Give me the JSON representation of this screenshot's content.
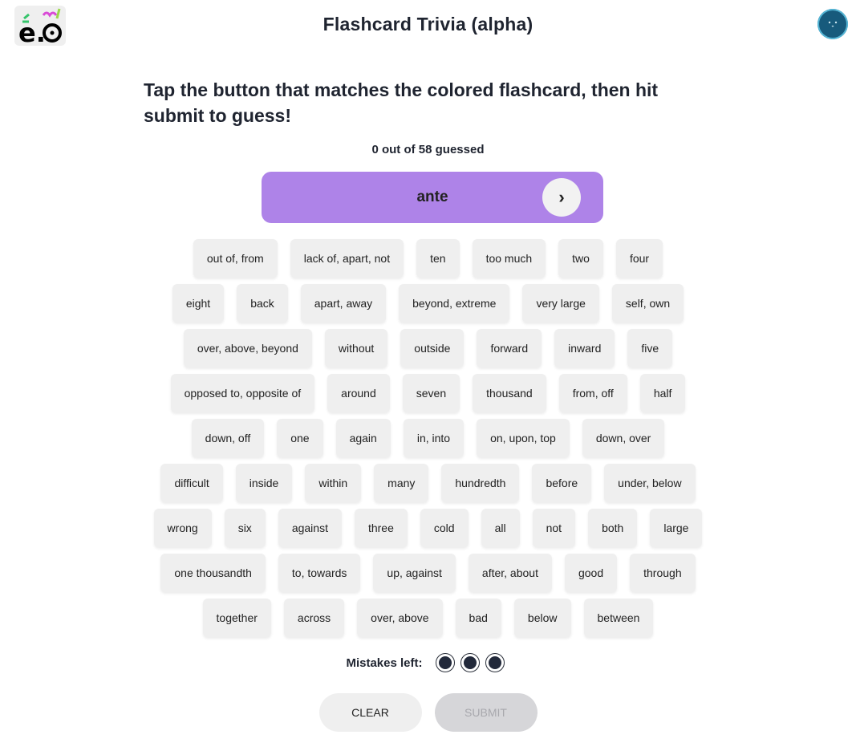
{
  "app": {
    "title": "Flashcard Trivia (alpha)",
    "logo_text": "e.o"
  },
  "instructions": "Tap the button that matches the colored flashcard, then hit submit to guess!",
  "progress_text": "0 out of 58 guessed",
  "flashcard": {
    "word": "ante",
    "color": "#ae83e8",
    "next_icon": "chevron-right-icon",
    "next_symbol": "›"
  },
  "choices": [
    [
      "out of, from",
      "lack of, apart, not",
      "ten",
      "too much",
      "two",
      "four"
    ],
    [
      "eight",
      "back",
      "apart, away",
      "beyond, extreme",
      "very large",
      "self, own"
    ],
    [
      "over, above, beyond",
      "without",
      "outside",
      "forward",
      "inward",
      "five"
    ],
    [
      "opposed to, opposite of",
      "around",
      "seven",
      "thousand",
      "from, off",
      "half"
    ],
    [
      "down, off",
      "one",
      "again",
      "in, into",
      "on, upon, top",
      "down, over"
    ],
    [
      "difficult",
      "inside",
      "within",
      "many",
      "hundredth",
      "before",
      "under, below"
    ],
    [
      "wrong",
      "six",
      "against",
      "three",
      "cold",
      "all",
      "not",
      "both",
      "large"
    ],
    [
      "one thousandth",
      "to, towards",
      "up, against",
      "after, about",
      "good",
      "through"
    ],
    [
      "together",
      "across",
      "over, above",
      "bad",
      "below",
      "between"
    ]
  ],
  "mistakes": {
    "label": "Mistakes left:",
    "remaining": 3
  },
  "actions": {
    "clear_label": "CLEAR",
    "submit_label": "SUBMIT"
  },
  "colors": {
    "accent": "#ae83e8",
    "avatar": "#175a7c",
    "chip": "#efefef"
  }
}
